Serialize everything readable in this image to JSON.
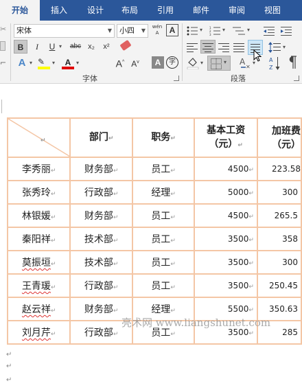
{
  "tabs": [
    "开始",
    "插入",
    "设计",
    "布局",
    "引用",
    "邮件",
    "审阅",
    "视图"
  ],
  "font": {
    "name": "宋体",
    "size": "小四",
    "wen_icon": "wén A",
    "A_box": "A",
    "bold": "B",
    "italic": "I",
    "underline": "U",
    "strike": "abc",
    "sub": "x₂",
    "sup": "x²",
    "eraser_icon": "eraser-icon",
    "grow": "A",
    "shrink": "A",
    "aa": "Aa",
    "char_shade": "A",
    "enclose": "字",
    "group_label": "字体"
  },
  "paragraph": {
    "group_label": "段落"
  },
  "table": {
    "headers": [
      "部门",
      "职务",
      "基本工资\n（元）",
      "加班费\n（元）"
    ],
    "rows": [
      {
        "name": "李秀丽",
        "dept": "财务部",
        "job": "员工",
        "salary": "4500",
        "overtime": "223.58"
      },
      {
        "name": "张秀玲",
        "dept": "行政部",
        "job": "经理",
        "salary": "5000",
        "overtime": "300"
      },
      {
        "name": "林银媛",
        "dept": "财务部",
        "job": "员工",
        "salary": "4500",
        "overtime": "265.5"
      },
      {
        "name": "秦阳祥",
        "dept": "技术部",
        "job": "员工",
        "salary": "3500",
        "overtime": "358"
      },
      {
        "name": "莫振垣",
        "dept": "技术部",
        "job": "员工",
        "salary": "3500",
        "overtime": "300"
      },
      {
        "name": "王青瑗",
        "dept": "行政部",
        "job": "员工",
        "salary": "3500",
        "overtime": "250.45"
      },
      {
        "name": "赵云祥",
        "dept": "财务部",
        "job": "经理",
        "salary": "5500",
        "overtime": "350.63"
      },
      {
        "name": "刘月芹",
        "dept": "行政部",
        "job": "员工",
        "salary": "3500",
        "overtime": "285"
      }
    ]
  },
  "watermark": "亮术网 www.liangshunet.com",
  "colors": {
    "ribbon_blue": "#2b579a",
    "table_border": "#f4c6a5",
    "highlight": "#ffff00",
    "font_red": "#e00000"
  }
}
